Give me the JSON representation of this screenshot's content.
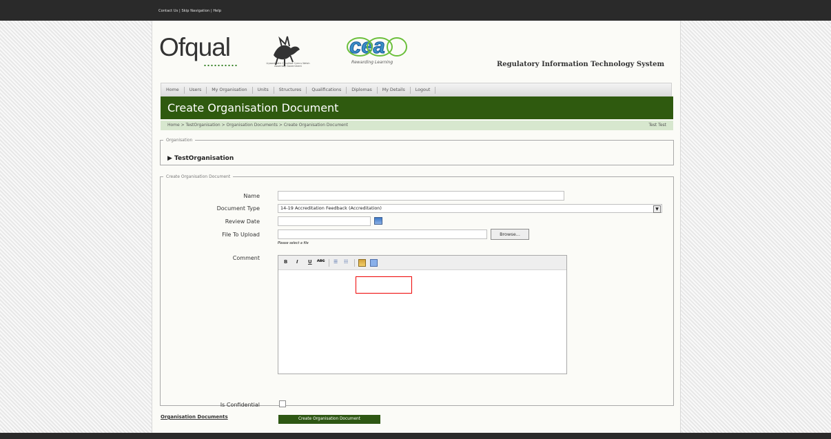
{
  "top": {
    "links": "Contact Us | Skip Navigation | Help"
  },
  "header": {
    "logo_text": "Ofqual",
    "cea_tagline": "Rewarding Learning",
    "wales_caption": "Llywodraeth Cynulliad Cymru Welsh Assembly Government",
    "system_title": "Regulatory Information Technology System"
  },
  "nav": {
    "items": [
      "Home",
      "Users",
      "My Organisation",
      "Units",
      "Structures",
      "Qualifications",
      "Diplomas",
      "My Details",
      "Logout"
    ]
  },
  "page": {
    "title": "Create Organisation Document",
    "breadcrumb": "Home > TestOrganisation > Organisation Documents > Create Organisation Document",
    "user": "Test Test"
  },
  "organisation": {
    "legend": "Organisation",
    "name": "▶ TestOrganisation"
  },
  "form": {
    "legend": "Create Organisation Document",
    "labels": {
      "name": "Name",
      "document_type": "Document Type",
      "review_date": "Review Date",
      "file_to_upload": "File To Upload",
      "comment": "Comment",
      "is_confidential": "Is Confidential"
    },
    "values": {
      "name": "",
      "document_type": "14-19 Accreditation Feedback (Accreditation)",
      "review_date": "",
      "file_to_upload": ""
    },
    "browse_label": "Browse...",
    "file_hint": "Please select a file",
    "submit_label": "Create Organisation Document",
    "toolbar": {
      "bold": "B",
      "italic": "I",
      "underline": "U",
      "strike": "ABC"
    }
  },
  "footer": {
    "link": "Organisation Documents"
  }
}
